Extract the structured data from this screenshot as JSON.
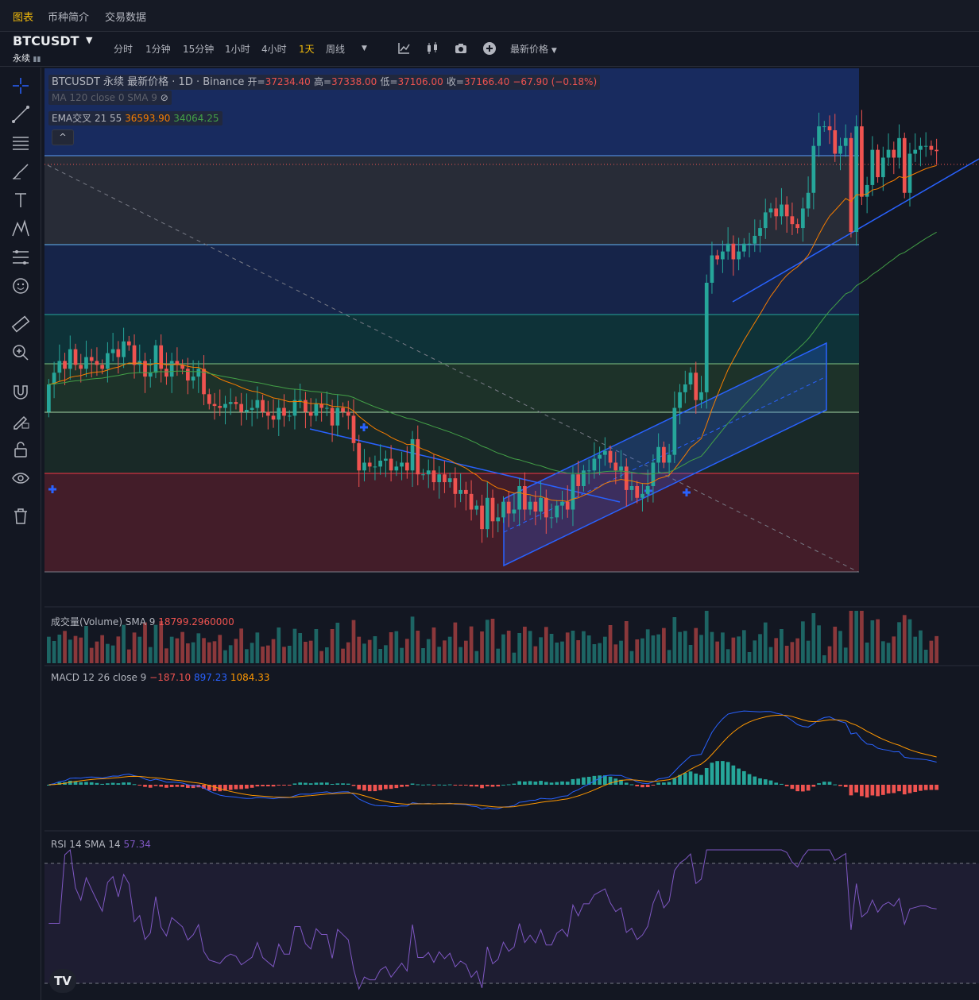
{
  "nav": {
    "tabs": [
      "图表",
      "币种简介",
      "交易数据"
    ],
    "active": 0
  },
  "toolbar": {
    "symbol": "BTCUSDT",
    "contract": "永续",
    "intervals": [
      "分时",
      "1分钟",
      "15分钟",
      "1小时",
      "4小时",
      "1天",
      "周线"
    ],
    "active_interval": "1天",
    "price_type": "最新价格"
  },
  "legend": {
    "title": "BTCUSDT 永续 最新价格 · 1D · Binance",
    "open_label": "开=",
    "open": "37234.40",
    "high_label": "高=",
    "high": "37338.00",
    "low_label": "低=",
    "low": "37106.00",
    "close_label": "收=",
    "close": "37166.40",
    "change": "−67.90 (−0.18%)",
    "ma_line": "MA 120 close 0 SMA 9",
    "ema_label": "EMA交叉 21 55",
    "ema21": "36593.90",
    "ema55": "34064.25"
  },
  "volume_legend": {
    "label": "成交量(Volume) SMA 9",
    "value": "18799.2960000"
  },
  "macd_legend": {
    "label": "MACD 12 26 close 9",
    "hist": "−187.10",
    "macd": "897.23",
    "signal": "1084.33"
  },
  "rsi_legend": {
    "label": "RSI 14 SMA 14",
    "value": "57.34"
  },
  "colors": {
    "up": "#26a69a",
    "down": "#ef5350",
    "accent": "#f0b90b",
    "ema_fast": "#f57c00",
    "ema_slow": "#43a047",
    "macd": "#2962ff",
    "signal": "#ff9800",
    "rsi": "#7e57c2"
  },
  "chart_data": [
    {
      "type": "candlestick",
      "open": [
        30500,
        31200,
        31500,
        31800,
        31600,
        32100,
        31700,
        31600,
        31900,
        31800,
        31700,
        31600,
        32000,
        32100,
        31900,
        32300,
        32200,
        31700,
        31800,
        31400,
        31500,
        32200,
        31600,
        31400,
        31800,
        31700,
        31600,
        31300,
        31400,
        31600,
        30950,
        30700,
        30650,
        30600,
        30700,
        30750,
        30700,
        30500,
        30550,
        30600,
        30800,
        30500,
        30400,
        30300,
        30600,
        30400,
        30400,
        30800,
        30800,
        30500,
        30400,
        30700,
        30600,
        30600,
        30150,
        30600,
        30500,
        30400,
        29700,
        29000,
        29200,
        29100,
        29100,
        29250,
        29300,
        29000,
        29100,
        29200,
        29000,
        29800,
        28900,
        28900,
        29000,
        28700,
        28900,
        28700,
        28800,
        28400,
        28500,
        28400,
        28000,
        28100,
        27500,
        28300,
        27700,
        27800,
        28200,
        27900,
        28000,
        28600,
        28000,
        28200,
        27950,
        28300,
        27800,
        27800,
        28100,
        28200,
        28000,
        28900,
        28600,
        29000,
        29000,
        29300,
        29400,
        29500,
        29200,
        29000,
        29100,
        28500,
        28600,
        28300,
        28400,
        28600,
        29200,
        29600,
        29200,
        29400,
        30600,
        31000,
        31200,
        31500,
        30800,
        31000,
        33800,
        34500,
        34400,
        34600,
        34800,
        34400,
        34600,
        34800,
        34800,
        35000,
        35200,
        35600,
        35700,
        35500,
        35800,
        35500,
        35300,
        35200,
        35700,
        36100,
        37300,
        37800,
        37800,
        37700,
        37100,
        37300,
        37500,
        35100,
        37800,
        36000,
        36300,
        37200,
        36500,
        37000,
        37200,
        37000,
        37500,
        36100,
        37100,
        37200,
        37300,
        37300,
        37200
      ],
      "close": [
        31200,
        31500,
        31800,
        31600,
        32100,
        31700,
        31600,
        31900,
        31800,
        31700,
        31600,
        32000,
        32100,
        31900,
        32300,
        32200,
        31700,
        31800,
        31400,
        31500,
        32200,
        31600,
        31400,
        31800,
        31700,
        31600,
        31300,
        31400,
        31600,
        30950,
        30700,
        30650,
        30600,
        30700,
        30750,
        30700,
        30500,
        30550,
        30600,
        30800,
        30500,
        30400,
        30300,
        30600,
        30400,
        30400,
        30800,
        30800,
        30500,
        30400,
        30700,
        30600,
        30600,
        30150,
        30600,
        30500,
        30400,
        29700,
        29000,
        29200,
        29100,
        29100,
        29250,
        29300,
        29000,
        29100,
        29200,
        29000,
        29800,
        28900,
        28900,
        29000,
        28700,
        28900,
        28700,
        28800,
        28400,
        28500,
        28400,
        28000,
        28100,
        27500,
        28300,
        27700,
        27800,
        28200,
        27900,
        28000,
        28600,
        28000,
        28200,
        27950,
        28300,
        27800,
        27800,
        28100,
        28200,
        28000,
        28900,
        28600,
        29000,
        29000,
        29300,
        29400,
        29500,
        29200,
        29000,
        29100,
        28500,
        28600,
        28300,
        28400,
        28600,
        29200,
        29600,
        29200,
        29400,
        30600,
        31000,
        31200,
        31500,
        30800,
        31000,
        33800,
        34500,
        34400,
        34600,
        34800,
        34400,
        34600,
        34800,
        34800,
        35000,
        35200,
        35600,
        35700,
        35500,
        35800,
        35500,
        35300,
        35200,
        35700,
        36100,
        37300,
        37800,
        37800,
        37700,
        37100,
        37300,
        37500,
        35100,
        37800,
        36000,
        36300,
        37200,
        36500,
        37000,
        37200,
        37000,
        37500,
        36100,
        37100,
        37200,
        37300,
        37300,
        37200,
        37166
      ],
      "high_pad": 350,
      "low_pad": 350
    },
    {
      "type": "bar",
      "name": "成交量(Volume)",
      "values": []
    },
    {
      "type": "line",
      "name": "MACD"
    },
    {
      "type": "line",
      "name": "RSI",
      "value": 57.34
    }
  ]
}
